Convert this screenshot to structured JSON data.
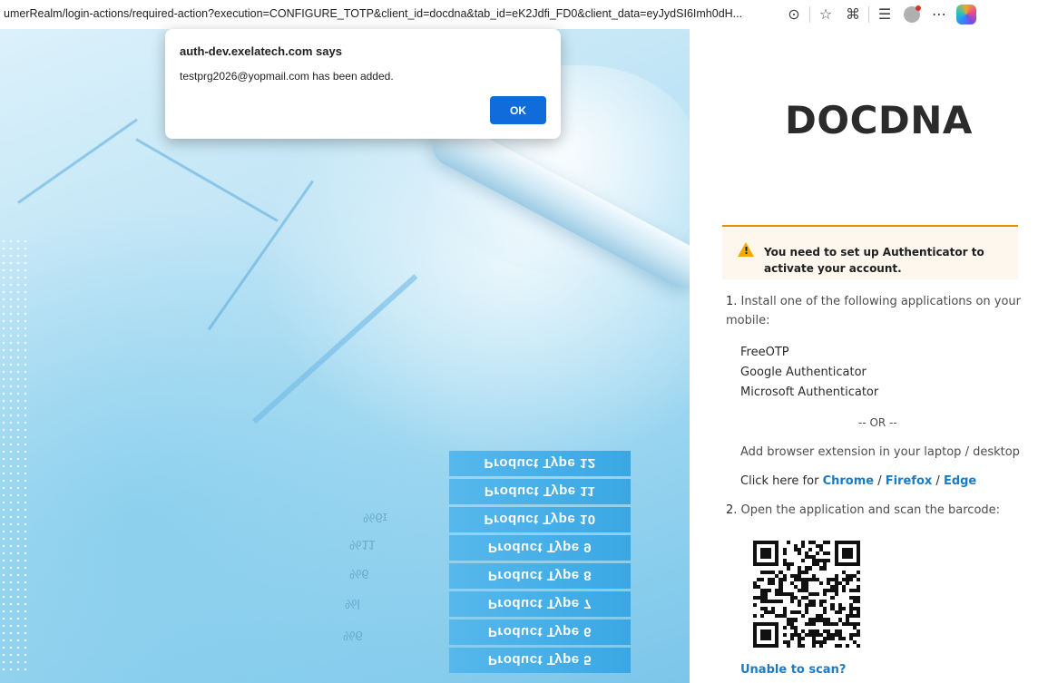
{
  "browser": {
    "url": "umerRealm/login-actions/required-action?execution=CONFIGURE_TOTP&client_id=docdna&tab_id=eK2Jdfi_FD0&client_data=eyJydSI6Imh0dH..."
  },
  "dialog": {
    "title": "auth-dev.exelatech.com says",
    "message": "testprg2026@yopmail.com has been added.",
    "ok_label": "OK"
  },
  "hero": {
    "product_rows": [
      "Product Type 12",
      "Product Type 11",
      "Product Type 10",
      "Product Type 9",
      "Product Type 8",
      "Product Type 7",
      "Product Type 6",
      "Product Type 5"
    ],
    "percents": [
      "%6ɪ",
      "%11",
      "%6",
      "%Ɩ",
      "%6"
    ]
  },
  "panel": {
    "brand": "DOCDNA",
    "alert_text": "You need to set up Authenticator to activate your account.",
    "step1_num": "1.",
    "step1_text": "Install one of the following applications on your mobile:",
    "apps": [
      "FreeOTP",
      "Google Authenticator",
      "Microsoft Authenticator"
    ],
    "or_text": "-- OR --",
    "extension_text": "Add browser extension in your laptop / desktop",
    "click_here": "Click here for",
    "chrome": "Chrome",
    "firefox": "Firefox",
    "edge": "Edge",
    "slash": " / ",
    "step2_num": "2.",
    "step2_text": "Open the application and scan the barcode:",
    "unable": "Unable to scan?"
  },
  "colors": {
    "ok_button": "#0f6cda",
    "alert_border": "#ec8b00",
    "warn_icon": "#f0ab00",
    "link": "#1a7bc9"
  }
}
